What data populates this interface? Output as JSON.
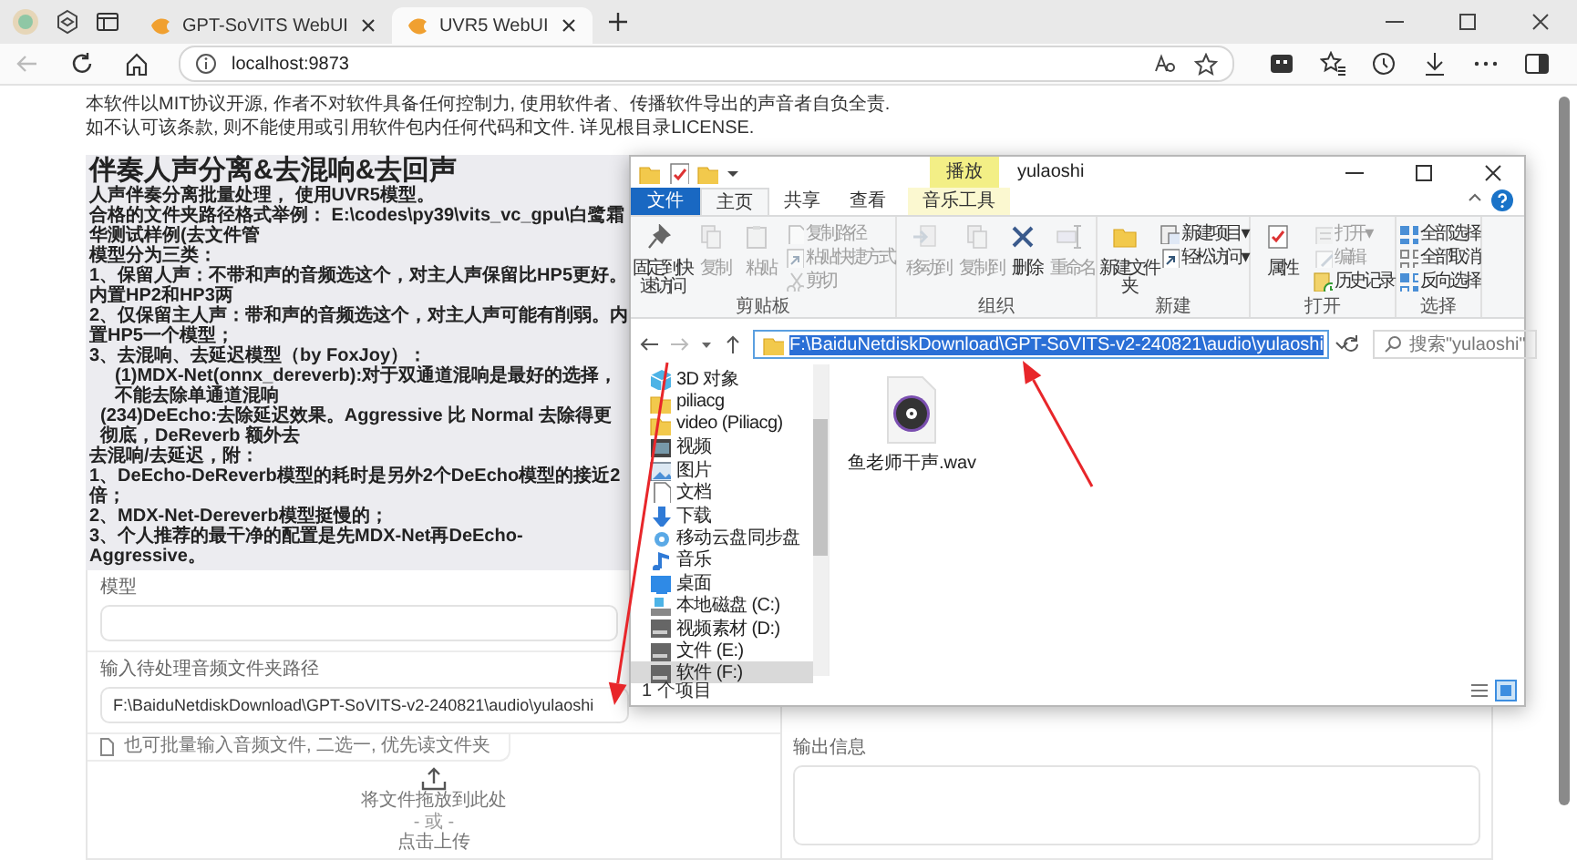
{
  "browser": {
    "tabs": [
      {
        "title": "GPT-SoVITS WebUI",
        "selected": false
      },
      {
        "title": "UVR5 WebUI",
        "selected": true
      }
    ],
    "back_disabled": true,
    "address": "localhost:9873"
  },
  "page": {
    "notice": [
      "本软件以MIT协议开源, 作者不对软件具备任何控制力, 使用软件者、传播软件导出的声音者自负全责.",
      "如不认可该条款, 则不能使用或引用软件包内任何代码和文件. 详见根目录LICENSE."
    ],
    "markdown": {
      "heading": "伴奏人声分离&去混响&去回声",
      "lines": [
        {
          "kind": "para",
          "text": "人声伴奏分离批量处理， 使用UVR5模型。"
        },
        {
          "kind": "para",
          "text": "合格的文件夹路径格式举例： E:\\codes\\py39\\vits_vc_gpu\\白鹭霜华测试样例(去文件管"
        },
        {
          "kind": "para",
          "text": "模型分为三类："
        },
        {
          "kind": "para",
          "text": "1、保留人声：不带和声的音频选这个，对主人声保留比HP5更好。内置HP2和HP3两"
        },
        {
          "kind": "para",
          "text": "2、仅保留主人声：带和声的音频选这个，对主人声可能有削弱。内置HP5一个模型；"
        },
        {
          "kind": "para",
          "text": "3、去混响、去延迟模型（by FoxJoy）："
        },
        {
          "kind": "indent-wide",
          "text": "(1)MDX-Net(onnx_dereverb):对于双通道混响是最好的选择，不能去除单通道混响"
        },
        {
          "kind": "indent",
          "text": "(234)DeEcho:去除延迟效果。Aggressive 比 Normal 去除得更彻底，DeReverb 额外去"
        },
        {
          "kind": "para",
          "text": "去混响/去延迟，附："
        },
        {
          "kind": "para",
          "text": "1、DeEcho-DeReverb模型的耗时是另外2个DeEcho模型的接近2倍；"
        },
        {
          "kind": "para",
          "text": "2、MDX-Net-Dereverb模型挺慢的；"
        },
        {
          "kind": "para",
          "text": "3、个人推荐的最干净的配置是先MDX-Net再DeEcho-Aggressive。"
        }
      ]
    },
    "model_field": {
      "label": "模型"
    },
    "path_field": {
      "label": "输入待处理音频文件夹路径",
      "value": "F:\\BaiduNetdiskDownload\\GPT-SoVITS-v2-240821\\audio\\yulaoshi"
    },
    "file_hint": "也可批量输入音频文件, 二选一, 优先读文件夹",
    "upload": {
      "title": "将文件拖放到此处",
      "or": "- 或 -",
      "action": "点击上传"
    },
    "output": {
      "label": "输出信息"
    }
  },
  "explorer": {
    "title": "yulaoshi",
    "context_header": "播放",
    "tabs": [
      {
        "label": "文件",
        "kind": "file",
        "selected": false
      },
      {
        "label": "主页",
        "kind": "normal",
        "selected": true
      },
      {
        "label": "共享",
        "kind": "normal",
        "selected": false
      },
      {
        "label": "查看",
        "kind": "normal",
        "selected": false
      },
      {
        "label": "音乐工具",
        "kind": "context",
        "selected": false
      }
    ],
    "groups": [
      {
        "name": "剪贴板",
        "buttons": [
          {
            "label": "固定到快速访问",
            "kind": "large",
            "disabled": false
          },
          {
            "label": "复制",
            "kind": "large",
            "disabled": true
          },
          {
            "label": "粘贴",
            "kind": "large",
            "disabled": true
          },
          {
            "label": "复制路径",
            "kind": "small",
            "disabled": true
          },
          {
            "label": "粘贴快捷方式",
            "kind": "small",
            "disabled": true
          },
          {
            "label": "剪切",
            "kind": "small",
            "disabled": true
          }
        ]
      },
      {
        "name": "组织",
        "buttons": [
          {
            "label": "移动到",
            "kind": "large",
            "disabled": true
          },
          {
            "label": "复制到",
            "kind": "large",
            "disabled": true
          },
          {
            "label": "删除",
            "kind": "large",
            "disabled": false
          },
          {
            "label": "重命名",
            "kind": "large",
            "disabled": true
          }
        ]
      },
      {
        "name": "新建",
        "buttons": [
          {
            "label": "新建文件夹",
            "kind": "large",
            "disabled": false
          },
          {
            "label": "新建项目 ▾",
            "kind": "small",
            "disabled": false
          },
          {
            "label": "轻松访问 ▾",
            "kind": "small",
            "disabled": false
          }
        ]
      },
      {
        "name": "打开",
        "buttons": [
          {
            "label": "属性",
            "kind": "large",
            "disabled": false
          },
          {
            "label": "打开 ▾",
            "kind": "small",
            "disabled": true
          },
          {
            "label": "编辑",
            "kind": "small",
            "disabled": true
          },
          {
            "label": "历史记录",
            "kind": "small",
            "disabled": false
          }
        ]
      },
      {
        "name": "选择",
        "buttons": [
          {
            "label": "全部选择",
            "kind": "small",
            "disabled": false
          },
          {
            "label": "全部取消",
            "kind": "small",
            "disabled": false
          },
          {
            "label": "反向选择",
            "kind": "small",
            "disabled": false
          }
        ]
      }
    ],
    "address": "F:\\BaiduNetdiskDownload\\GPT-SoVITS-v2-240821\\audio\\yulaoshi",
    "address_selected": true,
    "search_placeholder": "搜索\"yulaoshi\"",
    "tree": [
      {
        "label": "3D 对象",
        "selected": false
      },
      {
        "label": "piliacg",
        "selected": false
      },
      {
        "label": "video (Piliacg)",
        "selected": false
      },
      {
        "label": "视频",
        "selected": false
      },
      {
        "label": "图片",
        "selected": false
      },
      {
        "label": "文档",
        "selected": false
      },
      {
        "label": "下载",
        "selected": false
      },
      {
        "label": "移动云盘同步盘",
        "selected": false
      },
      {
        "label": "音乐",
        "selected": false
      },
      {
        "label": "桌面",
        "selected": false
      },
      {
        "label": "本地磁盘 (C:)",
        "selected": false
      },
      {
        "label": "视频素材 (D:)",
        "selected": false
      },
      {
        "label": "文件 (E:)",
        "selected": false
      },
      {
        "label": "软件 (F:)",
        "selected": true
      }
    ],
    "files": [
      {
        "name": "鱼老师干声.wav"
      }
    ],
    "status": "1 个项目"
  },
  "annotations": [
    {
      "kind": "arrow"
    },
    {
      "kind": "arrow"
    }
  ]
}
